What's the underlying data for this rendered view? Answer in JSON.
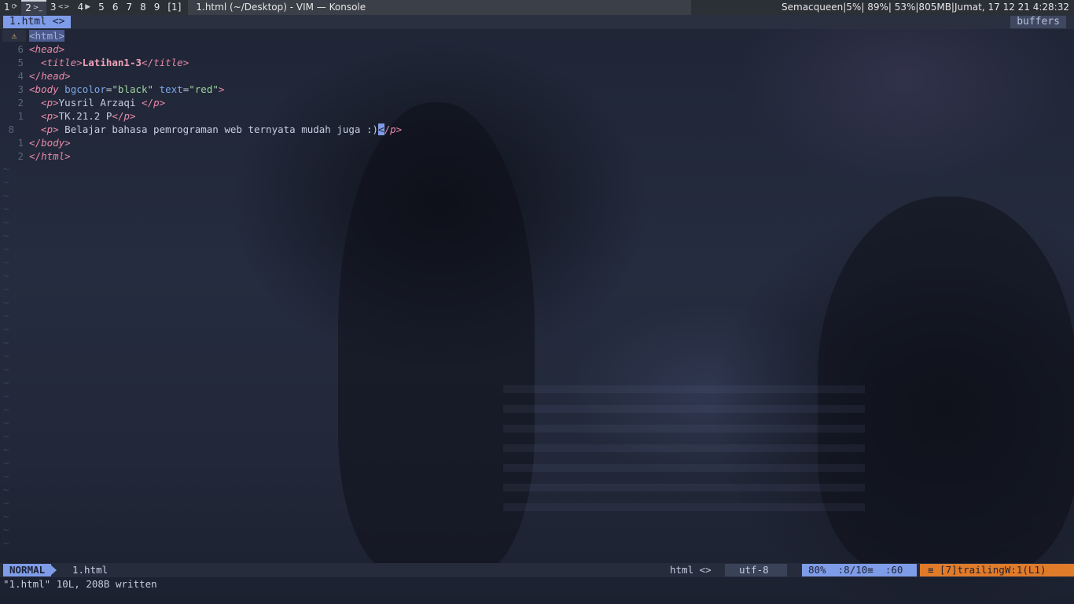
{
  "panel": {
    "workspaces": [
      {
        "label": "1",
        "sub": "⟳",
        "active": false
      },
      {
        "label": "2",
        "sub": ">_",
        "active": true
      },
      {
        "label": "3",
        "sub": "<>",
        "active": false
      },
      {
        "label": "4",
        "sub": "▶",
        "active": false
      },
      {
        "label": "5",
        "sub": "",
        "active": false
      },
      {
        "label": "6",
        "sub": "",
        "active": false
      },
      {
        "label": "7",
        "sub": "",
        "active": false
      },
      {
        "label": "8",
        "sub": "",
        "active": false
      },
      {
        "label": "9",
        "sub": "",
        "active": false
      },
      {
        "label": "[1]",
        "sub": "",
        "active": false
      }
    ],
    "window_title": "1.html (~/Desktop) - VIM — Konsole",
    "status": "Semacqueen|5%| 89%| 53%|805MB|Jumat, 17 12 21 4:28:32"
  },
  "tabline": {
    "active_tab": "1.html <>",
    "right_label": "buffers"
  },
  "editor": {
    "lines": [
      {
        "num": "",
        "warn": "⚠",
        "segments": [
          {
            "t": "<html>",
            "c": "sel"
          }
        ]
      },
      {
        "num": "6",
        "segments": [
          {
            "t": "<",
            "c": "tag"
          },
          {
            "t": "head",
            "c": "kw"
          },
          {
            "t": ">",
            "c": "tag"
          }
        ]
      },
      {
        "num": "5",
        "segments": [
          {
            "t": "  <",
            "c": "tag"
          },
          {
            "t": "title",
            "c": "kw"
          },
          {
            "t": ">",
            "c": "tag"
          },
          {
            "t": "Latihan1-3",
            "c": "bold"
          },
          {
            "t": "</",
            "c": "tag"
          },
          {
            "t": "title",
            "c": "kw"
          },
          {
            "t": ">",
            "c": "tag"
          }
        ]
      },
      {
        "num": "4",
        "segments": [
          {
            "t": "</",
            "c": "tag"
          },
          {
            "t": "head",
            "c": "kw"
          },
          {
            "t": ">",
            "c": "tag"
          }
        ]
      },
      {
        "num": "3",
        "segments": [
          {
            "t": "<",
            "c": "tag"
          },
          {
            "t": "body",
            "c": "kw"
          },
          {
            "t": " bgcolor",
            "c": "attr"
          },
          {
            "t": "=",
            "c": "txt"
          },
          {
            "t": "\"black\"",
            "c": "str"
          },
          {
            "t": " text",
            "c": "attr"
          },
          {
            "t": "=",
            "c": "txt"
          },
          {
            "t": "\"red\"",
            "c": "str"
          },
          {
            "t": ">",
            "c": "tag"
          }
        ]
      },
      {
        "num": "2",
        "segments": [
          {
            "t": "  <",
            "c": "tag"
          },
          {
            "t": "p",
            "c": "kw"
          },
          {
            "t": ">",
            "c": "tag"
          },
          {
            "t": "Yusril Arzaqi ",
            "c": "txt"
          },
          {
            "t": "</",
            "c": "tag"
          },
          {
            "t": "p",
            "c": "kw"
          },
          {
            "t": ">",
            "c": "tag"
          }
        ]
      },
      {
        "num": "1",
        "segments": [
          {
            "t": "  <",
            "c": "tag"
          },
          {
            "t": "p",
            "c": "kw"
          },
          {
            "t": ">",
            "c": "tag"
          },
          {
            "t": "TK.21.2 P",
            "c": "txt"
          },
          {
            "t": "</",
            "c": "tag"
          },
          {
            "t": "p",
            "c": "kw"
          },
          {
            "t": ">",
            "c": "tag"
          }
        ]
      },
      {
        "num": "8",
        "current": true,
        "segments": [
          {
            "t": "  <",
            "c": "tag"
          },
          {
            "t": "p",
            "c": "kw"
          },
          {
            "t": ">",
            "c": "tag"
          },
          {
            "t": " Belajar bahasa pemrograman web ternyata mudah juga :)",
            "c": "txt"
          },
          {
            "t": "<",
            "c": "cursor"
          },
          {
            "t": "/",
            "c": "tag"
          },
          {
            "t": "p",
            "c": "kw"
          },
          {
            "t": ">",
            "c": "tag"
          }
        ]
      },
      {
        "num": "1",
        "segments": [
          {
            "t": "</",
            "c": "tag"
          },
          {
            "t": "body",
            "c": "kw"
          },
          {
            "t": ">",
            "c": "tag"
          }
        ]
      },
      {
        "num": "2",
        "segments": [
          {
            "t": "</",
            "c": "tag"
          },
          {
            "t": "html",
            "c": "kw"
          },
          {
            "t": ">",
            "c": "tag"
          }
        ]
      }
    ],
    "empty_marker": "~"
  },
  "statusline": {
    "mode": "NORMAL",
    "filename": "1.html",
    "filetype": "html <>",
    "encoding": "utf-8  ",
    "position": "80%  :8/10≡  :60",
    "warning": "≡ [7]trailingW:1(L1)"
  },
  "cmdline": "\"1.html\" 10L, 208B written"
}
